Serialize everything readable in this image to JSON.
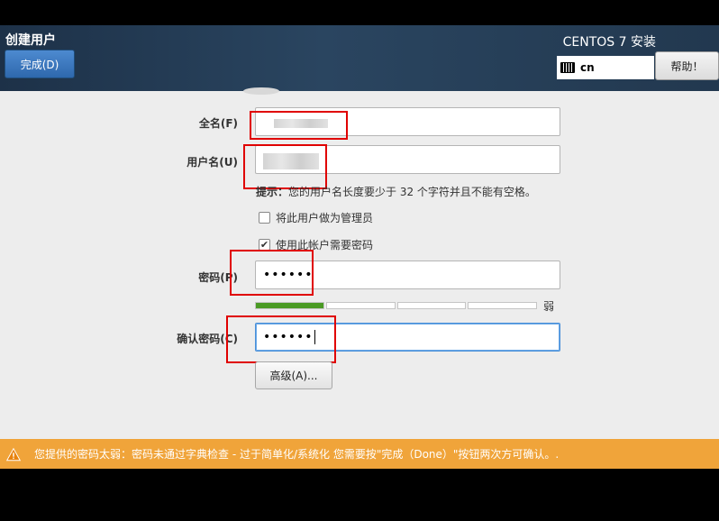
{
  "header": {
    "title": "创建用户",
    "done_button": "完成(D)",
    "product": "CENTOS 7 安装",
    "keyboard_layout": "cn",
    "help_button": "帮助！"
  },
  "form": {
    "fullname_label": "全名(F)",
    "username_label": "用户名(U)",
    "hint_bold": "提示：",
    "hint_text": "您的用户名长度要少于 32 个字符并且不能有空格。",
    "admin_checkbox_label": "将此用户做为管理员",
    "admin_checked": false,
    "require_password_label": "使用此帐户需要密码",
    "require_password_checked": true,
    "password_label": "密码(P)",
    "password_value": "••••••",
    "strength_fraction": 0.25,
    "strength_label": "弱",
    "confirm_label": "确认密码(C)",
    "confirm_value": "••••••",
    "advanced_button": "高级(A)..."
  },
  "warning": {
    "text": "您提供的密码太弱：密码未通过字典检查 - 过于简单化/系统化 您需要按\"完成（Done）\"按钮两次方可确认。.",
    "color": "#f0a43a"
  }
}
